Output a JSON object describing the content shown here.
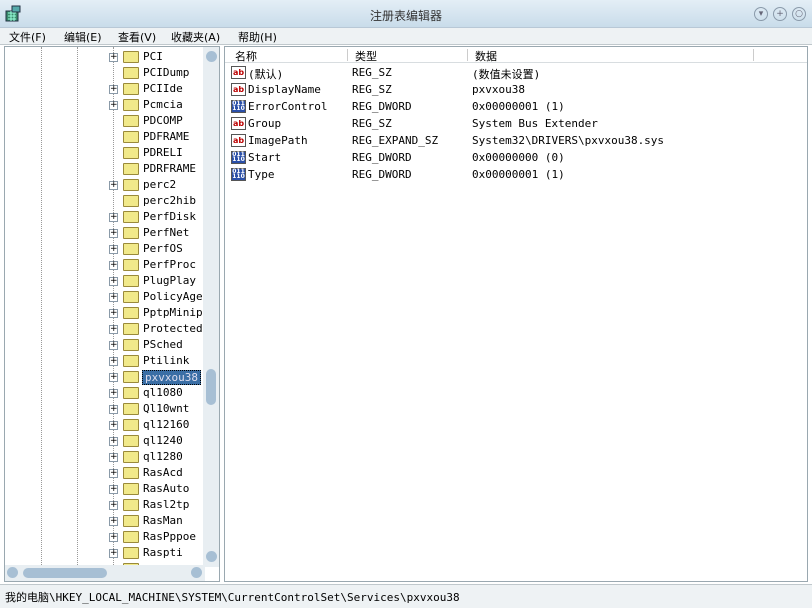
{
  "window": {
    "title": "注册表编辑器"
  },
  "menu": [
    "文件(F)",
    "编辑(E)",
    "查看(V)",
    "收藏夹(A)",
    "帮助(H)"
  ],
  "tree": {
    "selected": "pxvxou38",
    "items": [
      {
        "label": "PCI",
        "expandable": true
      },
      {
        "label": "PCIDump",
        "expandable": false
      },
      {
        "label": "PCIIde",
        "expandable": true
      },
      {
        "label": "Pcmcia",
        "expandable": true
      },
      {
        "label": "PDCOMP",
        "expandable": false
      },
      {
        "label": "PDFRAME",
        "expandable": false
      },
      {
        "label": "PDRELI",
        "expandable": false
      },
      {
        "label": "PDRFRAME",
        "expandable": false
      },
      {
        "label": "perc2",
        "expandable": true
      },
      {
        "label": "perc2hib",
        "expandable": false
      },
      {
        "label": "PerfDisk",
        "expandable": true
      },
      {
        "label": "PerfNet",
        "expandable": true
      },
      {
        "label": "PerfOS",
        "expandable": true
      },
      {
        "label": "PerfProc",
        "expandable": true
      },
      {
        "label": "PlugPlay",
        "expandable": true
      },
      {
        "label": "PolicyAger",
        "expandable": true
      },
      {
        "label": "PptpMinipo",
        "expandable": true
      },
      {
        "label": "ProtectedS",
        "expandable": true
      },
      {
        "label": "PSched",
        "expandable": true
      },
      {
        "label": "Ptilink",
        "expandable": true
      },
      {
        "label": "pxvxou38",
        "expandable": true
      },
      {
        "label": "ql1080",
        "expandable": true
      },
      {
        "label": "Ql10wnt",
        "expandable": true
      },
      {
        "label": "ql12160",
        "expandable": true
      },
      {
        "label": "ql1240",
        "expandable": true
      },
      {
        "label": "ql1280",
        "expandable": true
      },
      {
        "label": "RasAcd",
        "expandable": true
      },
      {
        "label": "RasAuto",
        "expandable": true
      },
      {
        "label": "Rasl2tp",
        "expandable": true
      },
      {
        "label": "RasMan",
        "expandable": true
      },
      {
        "label": "RasPppoe",
        "expandable": true
      },
      {
        "label": "Raspti",
        "expandable": true
      },
      {
        "label": "",
        "expandable": true
      }
    ]
  },
  "list": {
    "columns": [
      "名称",
      "类型",
      "数据"
    ],
    "rows": [
      {
        "icon": "string-value-icon",
        "name": "(默认)",
        "type": "REG_SZ",
        "data": "(数值未设置)"
      },
      {
        "icon": "string-value-icon",
        "name": "DisplayName",
        "type": "REG_SZ",
        "data": "pxvxou38"
      },
      {
        "icon": "binary-value-icon",
        "name": "ErrorControl",
        "type": "REG_DWORD",
        "data": "0x00000001 (1)"
      },
      {
        "icon": "string-value-icon",
        "name": "Group",
        "type": "REG_SZ",
        "data": "System Bus Extender"
      },
      {
        "icon": "string-value-icon",
        "name": "ImagePath",
        "type": "REG_EXPAND_SZ",
        "data": "System32\\DRIVERS\\pxvxou38.sys"
      },
      {
        "icon": "binary-value-icon",
        "name": "Start",
        "type": "REG_DWORD",
        "data": "0x00000000 (0)"
      },
      {
        "icon": "binary-value-icon",
        "name": "Type",
        "type": "REG_DWORD",
        "data": "0x00000001 (1)"
      }
    ]
  },
  "status": {
    "path": "我的电脑\\HKEY_LOCAL_MACHINE\\SYSTEM\\CurrentControlSet\\Services\\pxvxou38"
  }
}
